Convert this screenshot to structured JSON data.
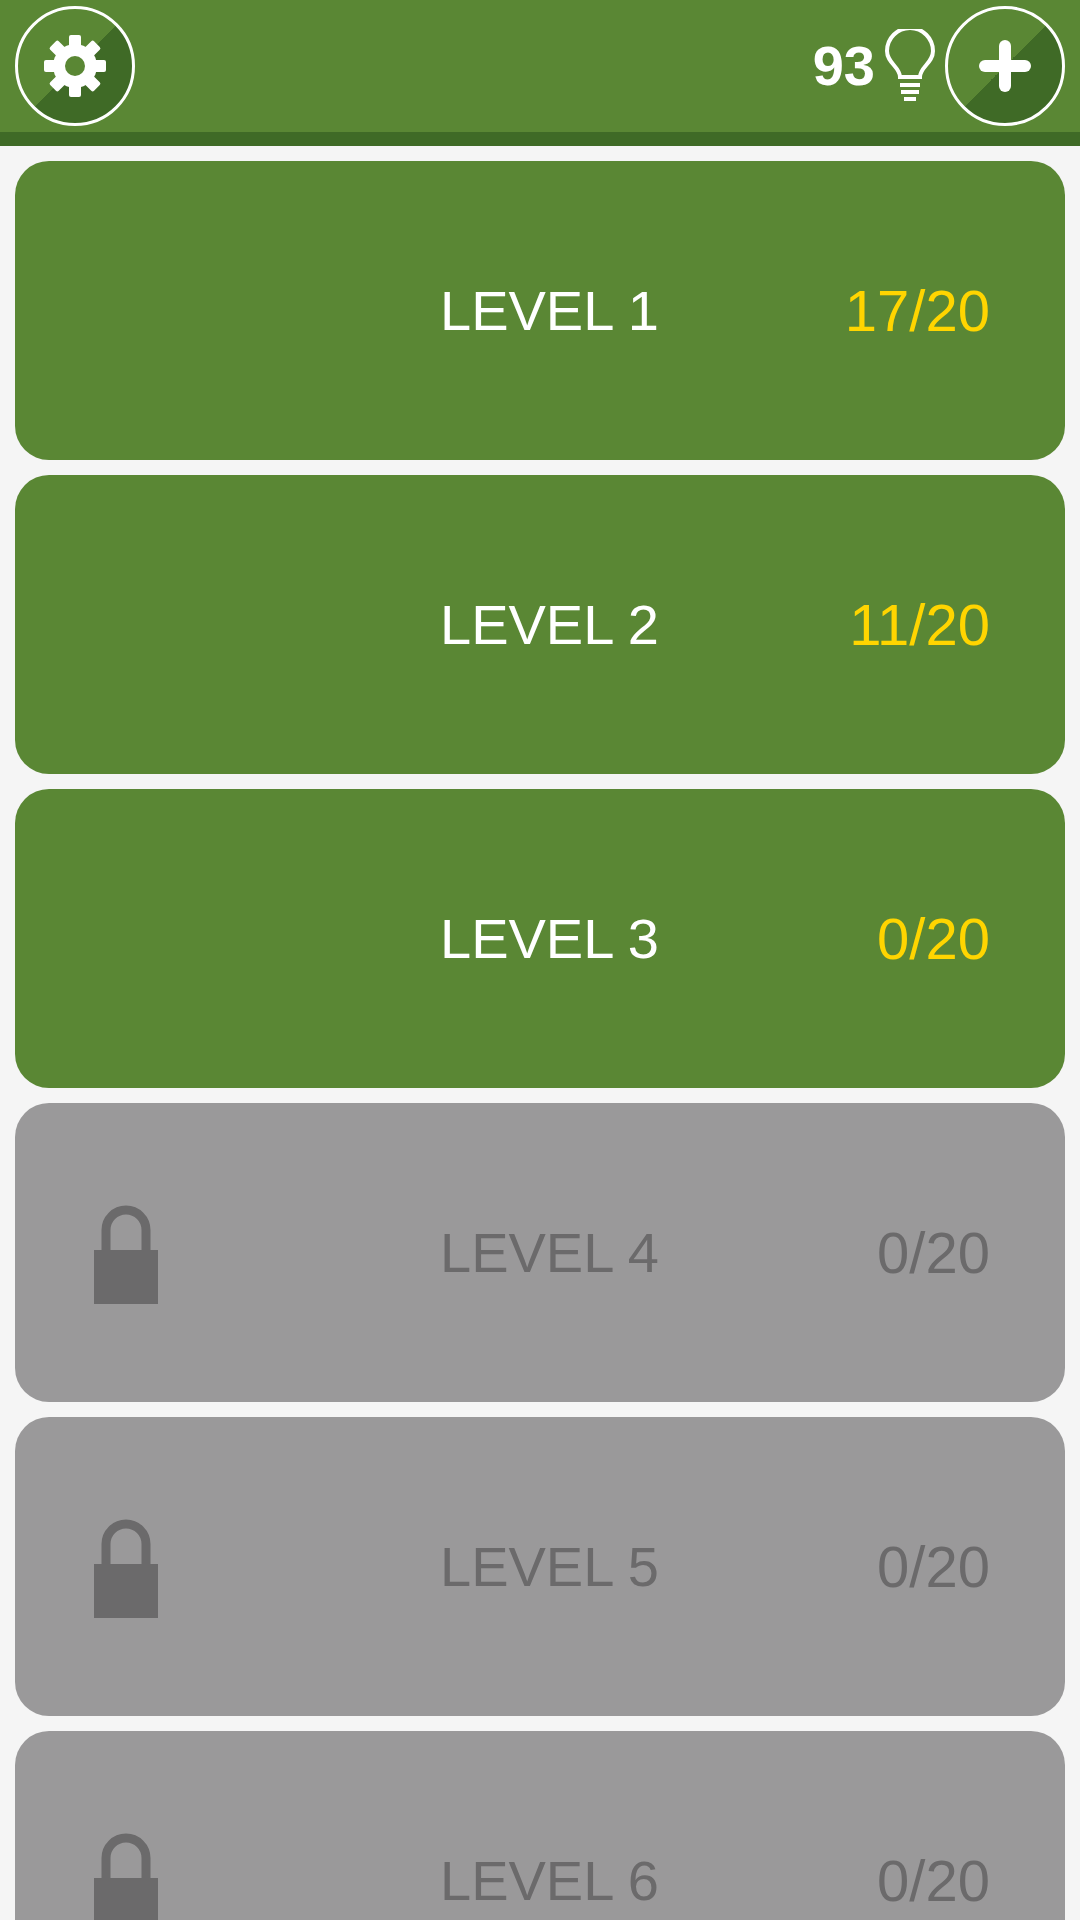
{
  "header": {
    "hint_count": "93"
  },
  "levels": [
    {
      "label": "LEVEL 1",
      "score": "17/20",
      "locked": false
    },
    {
      "label": "LEVEL 2",
      "score": "11/20",
      "locked": false
    },
    {
      "label": "LEVEL 3",
      "score": "0/20",
      "locked": false
    },
    {
      "label": "LEVEL 4",
      "score": "0/20",
      "locked": true
    },
    {
      "label": "LEVEL 5",
      "score": "0/20",
      "locked": true
    },
    {
      "label": "LEVEL 6",
      "score": "0/20",
      "locked": true
    }
  ]
}
